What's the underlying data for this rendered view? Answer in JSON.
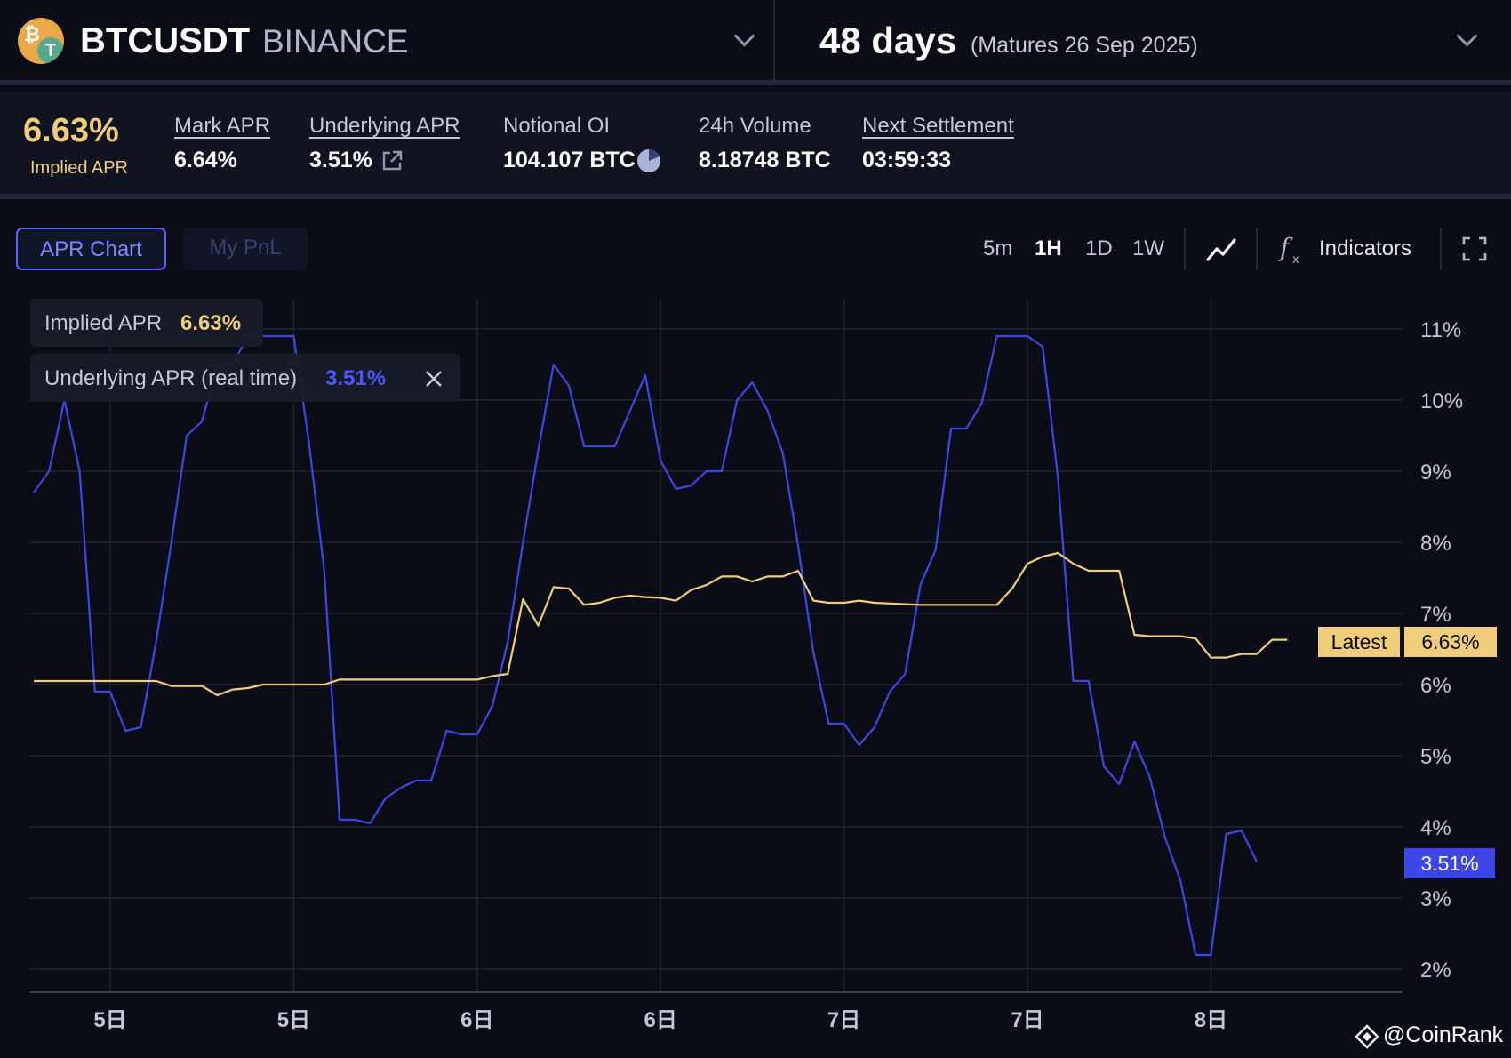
{
  "header": {
    "symbol": "BTCUSDT",
    "exchange": "BINANCE",
    "days": "48 days",
    "maturity": "(Matures 26 Sep 2025)"
  },
  "stats": {
    "implied_apr": "6.63%",
    "implied_apr_label": "Implied APR",
    "mark_apr_label": "Mark APR",
    "mark_apr": "6.64%",
    "underlying_apr_label": "Underlying APR",
    "underlying_apr": "3.51%",
    "notional_oi_label": "Notional OI",
    "notional_oi": "104.107 BTC",
    "volume_label": "24h Volume",
    "volume": "8.18748 BTC",
    "settlement_label": "Next Settlement",
    "settlement": "03:59:33"
  },
  "tabs": [
    "APR Chart",
    "My PnL"
  ],
  "timeframes": [
    "5m",
    "1H",
    "1D",
    "1W"
  ],
  "selected_timeframe": "1H",
  "indicators_label": "Indicators",
  "legend": {
    "implied_label": "Implied APR",
    "implied_value": "6.63%",
    "underlying_label": "Underlying APR (real time)",
    "underlying_value": "3.51%"
  },
  "tags": {
    "latest_label": "Latest",
    "latest_value": "6.63%",
    "underlying_value": "3.51%"
  },
  "watermark": "@CoinRank",
  "colors": {
    "implied": "#f0cd7a",
    "underlying": "#3f46e6",
    "background": "#0b0d16"
  },
  "chart_data": {
    "type": "line",
    "x_unit": "hours",
    "x_range": [
      0,
      93
    ],
    "ylim": [
      1.7,
      11.5
    ],
    "y_ticks": [
      2,
      3,
      4,
      5,
      6,
      7,
      8,
      9,
      10,
      11
    ],
    "y_tick_labels": [
      "2%",
      "3%",
      "4%",
      "5%",
      "6%",
      "7%",
      "8%",
      "9%",
      "10%",
      "11%"
    ],
    "x_ticks": [
      {
        "x": 5,
        "label": "5日"
      },
      {
        "x": 17,
        "label": "5日"
      },
      {
        "x": 29,
        "label": "6日"
      },
      {
        "x": 41,
        "label": "6日"
      },
      {
        "x": 53,
        "label": "7日"
      },
      {
        "x": 65,
        "label": "7日"
      },
      {
        "x": 77,
        "label": "8日"
      }
    ],
    "series": [
      {
        "name": "Underlying APR (real time)",
        "points": [
          [
            0,
            8.7
          ],
          [
            1,
            9.0
          ],
          [
            2,
            10.0
          ],
          [
            3,
            9.0
          ],
          [
            4,
            5.9
          ],
          [
            5,
            5.9
          ],
          [
            6,
            5.35
          ],
          [
            7,
            5.4
          ],
          [
            8,
            6.6
          ],
          [
            9,
            8.0
          ],
          [
            10,
            9.5
          ],
          [
            11,
            9.7
          ],
          [
            12,
            10.5
          ],
          [
            13,
            10.5
          ],
          [
            14,
            10.9
          ],
          [
            15,
            10.9
          ],
          [
            16,
            10.9
          ],
          [
            17,
            10.9
          ],
          [
            18,
            9.4
          ],
          [
            19,
            7.6
          ],
          [
            20,
            4.1
          ],
          [
            21,
            4.1
          ],
          [
            22,
            4.05
          ],
          [
            23,
            4.4
          ],
          [
            24,
            4.55
          ],
          [
            25,
            4.65
          ],
          [
            26,
            4.65
          ],
          [
            27,
            5.35
          ],
          [
            28,
            5.3
          ],
          [
            29,
            5.3
          ],
          [
            30,
            5.7
          ],
          [
            31,
            6.6
          ],
          [
            32,
            8.0
          ],
          [
            33,
            9.3
          ],
          [
            34,
            10.5
          ],
          [
            35,
            10.2
          ],
          [
            36,
            9.35
          ],
          [
            37,
            9.35
          ],
          [
            38,
            9.35
          ],
          [
            39,
            9.85
          ],
          [
            40,
            10.35
          ],
          [
            41,
            9.15
          ],
          [
            42,
            8.75
          ],
          [
            43,
            8.8
          ],
          [
            44,
            9.0
          ],
          [
            45,
            9.0
          ],
          [
            46,
            10.0
          ],
          [
            47,
            10.25
          ],
          [
            48,
            9.85
          ],
          [
            49,
            9.25
          ],
          [
            50,
            7.95
          ],
          [
            51,
            6.45
          ],
          [
            52,
            5.45
          ],
          [
            53,
            5.45
          ],
          [
            54,
            5.15
          ],
          [
            55,
            5.4
          ],
          [
            56,
            5.9
          ],
          [
            57,
            6.15
          ],
          [
            58,
            7.4
          ],
          [
            59,
            7.9
          ],
          [
            60,
            9.6
          ],
          [
            61,
            9.6
          ],
          [
            62,
            9.95
          ],
          [
            63,
            10.9
          ],
          [
            64,
            10.9
          ],
          [
            65,
            10.9
          ],
          [
            66,
            10.75
          ],
          [
            67,
            8.9
          ],
          [
            68,
            6.05
          ],
          [
            69,
            6.05
          ],
          [
            70,
            4.85
          ],
          [
            71,
            4.6
          ],
          [
            72,
            5.2
          ],
          [
            73,
            4.7
          ],
          [
            74,
            3.85
          ],
          [
            75,
            3.25
          ],
          [
            76,
            2.2
          ],
          [
            77,
            2.2
          ],
          [
            78,
            3.9
          ],
          [
            79,
            3.95
          ],
          [
            80,
            3.51
          ]
        ]
      },
      {
        "name": "Implied APR",
        "points": [
          [
            0,
            6.05
          ],
          [
            8,
            6.05
          ],
          [
            9,
            5.98
          ],
          [
            11,
            5.98
          ],
          [
            12,
            5.85
          ],
          [
            13,
            5.93
          ],
          [
            14,
            5.95
          ],
          [
            15,
            6.0
          ],
          [
            19,
            6.0
          ],
          [
            20,
            6.07
          ],
          [
            29,
            6.07
          ],
          [
            30,
            6.12
          ],
          [
            31,
            6.15
          ],
          [
            32,
            7.2
          ],
          [
            33,
            6.83
          ],
          [
            34,
            7.37
          ],
          [
            35,
            7.35
          ],
          [
            36,
            7.12
          ],
          [
            37,
            7.15
          ],
          [
            38,
            7.22
          ],
          [
            39,
            7.25
          ],
          [
            40,
            7.23
          ],
          [
            41,
            7.22
          ],
          [
            42,
            7.18
          ],
          [
            43,
            7.33
          ],
          [
            44,
            7.4
          ],
          [
            45,
            7.52
          ],
          [
            46,
            7.52
          ],
          [
            47,
            7.45
          ],
          [
            48,
            7.52
          ],
          [
            49,
            7.52
          ],
          [
            50,
            7.6
          ],
          [
            51,
            7.18
          ],
          [
            52,
            7.15
          ],
          [
            53,
            7.15
          ],
          [
            54,
            7.18
          ],
          [
            55,
            7.15
          ],
          [
            58,
            7.12
          ],
          [
            63,
            7.12
          ],
          [
            64,
            7.35
          ],
          [
            65,
            7.7
          ],
          [
            66,
            7.8
          ],
          [
            67,
            7.85
          ],
          [
            68,
            7.7
          ],
          [
            69,
            7.6
          ],
          [
            71,
            7.6
          ],
          [
            72,
            6.7
          ],
          [
            73,
            6.68
          ],
          [
            75,
            6.68
          ],
          [
            76,
            6.65
          ],
          [
            77,
            6.38
          ],
          [
            78,
            6.38
          ],
          [
            79,
            6.43
          ],
          [
            80,
            6.43
          ],
          [
            81,
            6.63
          ],
          [
            82,
            6.63
          ]
        ]
      }
    ]
  }
}
